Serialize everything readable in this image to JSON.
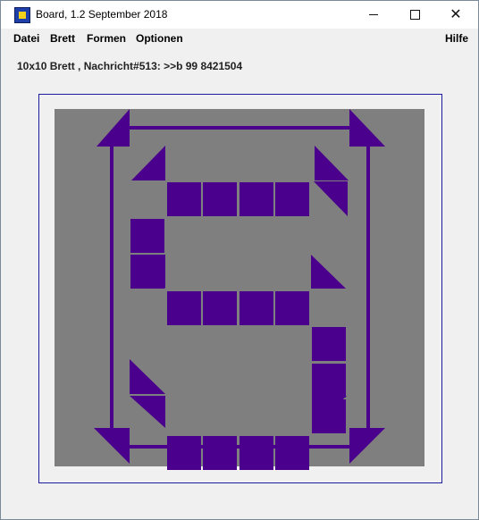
{
  "window": {
    "title": "Board, 1.2 September 2018",
    "controls": {
      "minimize": "minimize",
      "maximize": "maximize",
      "close": "close"
    }
  },
  "menubar": {
    "items": [
      "Datei",
      "Brett",
      "Formen",
      "Optionen"
    ],
    "help": "Hilfe"
  },
  "status": {
    "text": "10x10 Brett , Nachricht#513: >>b 99 8421504"
  },
  "board": {
    "size": "10x10",
    "background_color": "#7f7f7f",
    "piece_color": "#4a008c",
    "frame_color": "#1c1c9e",
    "shape": "S",
    "arrows": [
      "top",
      "bottom",
      "left",
      "right"
    ]
  }
}
